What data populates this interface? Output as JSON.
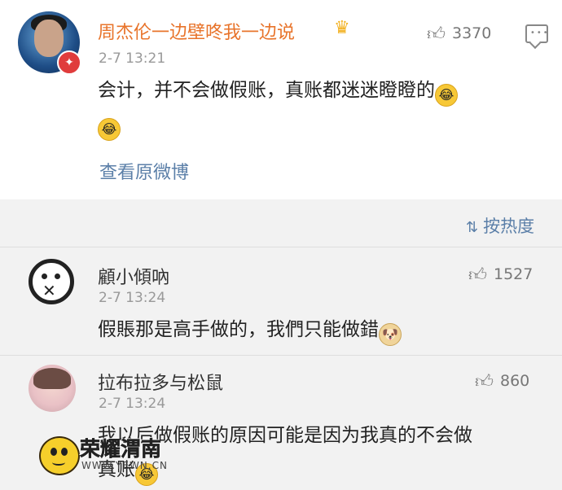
{
  "post": {
    "author": "周杰伦一边壁咚我一边说",
    "crown_icon": "crown-icon",
    "time": "2-7 13:21",
    "likes": "3370",
    "content_line1": "会计，并不会做假账，真账都迷迷瞪瞪的",
    "view_original": "查看原微博"
  },
  "sort": {
    "label": "按热度",
    "icon": "sort-icon"
  },
  "comments": [
    {
      "nickname": "顧小傾吶",
      "time": "2-7 13:24",
      "likes": "1527",
      "text": "假賬那是高手做的，我們只能做錯"
    },
    {
      "nickname": "拉布拉多与松鼠",
      "time": "2-7 13:24",
      "likes": "860",
      "text_line1": "我以后做假账的原因可能是因为我真的不会做",
      "text_line2": "真账"
    }
  ],
  "watermark": {
    "title": "荣耀渭南",
    "url": "WWW.YEWN.CN"
  }
}
